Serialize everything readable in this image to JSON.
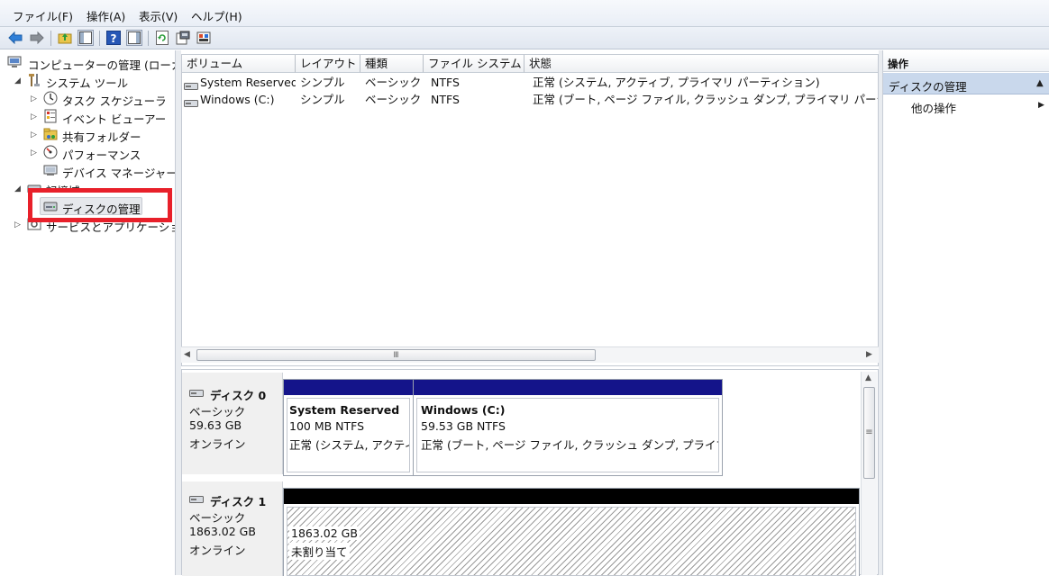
{
  "menu": [
    "ファイル(F)",
    "操作(A)",
    "表示(V)",
    "ヘルプ(H)"
  ],
  "tree": {
    "root": "コンピューターの管理 (ローカル)",
    "system_tools": "システム ツール",
    "task_scheduler": "タスク スケジューラ",
    "event_viewer": "イベント ビューアー",
    "shared_folders": "共有フォルダー",
    "performance": "パフォーマンス",
    "device_manager": "デバイス マネージャー",
    "storage": "記憶域",
    "disk_management": "ディスクの管理",
    "services_apps": "サービスとアプリケーション"
  },
  "volume_list": {
    "headers": [
      "ボリューム",
      "レイアウト",
      "種類",
      "ファイル システム",
      "状態"
    ],
    "rows": [
      [
        "System Reserved",
        "シンプル",
        "ベーシック",
        "NTFS",
        "正常 (システム, アクティブ, プライマリ パーティション)"
      ],
      [
        "Windows (C:)",
        "シンプル",
        "ベーシック",
        "NTFS",
        "正常 (ブート, ページ ファイル, クラッシュ ダンプ, プライマリ パーティション)"
      ]
    ]
  },
  "disks": [
    {
      "name": "ディスク 0",
      "type": "ベーシック",
      "size": "59.63 GB",
      "status": "オンライン",
      "partitions": [
        {
          "title": "System Reserved",
          "size": "100 MB NTFS",
          "status": "正常 (システム, アクティブ, プライマリ パーティション)"
        },
        {
          "title": "Windows  (C:)",
          "size": "59.53 GB NTFS",
          "status": "正常 (ブート, ページ ファイル, クラッシュ ダンプ, プライマリ パーティション)"
        }
      ]
    },
    {
      "name": "ディスク 1",
      "type": "ベーシック",
      "size": "1863.02 GB",
      "status": "オンライン",
      "partitions": [
        {
          "title": "",
          "size": "1863.02 GB",
          "status": "未割り当て"
        }
      ]
    }
  ],
  "actions": {
    "header": "操作",
    "section": "ディスクの管理",
    "more": "他の操作"
  },
  "hscroll_thumb": "Ⅲ",
  "vscroll_thumb": "≡",
  "colors": {
    "primary_partition_bar": "#14148a",
    "unallocated_bar": "#000000",
    "highlight_box": "#e8202a",
    "action_section_bg": "#c9d8ec"
  }
}
